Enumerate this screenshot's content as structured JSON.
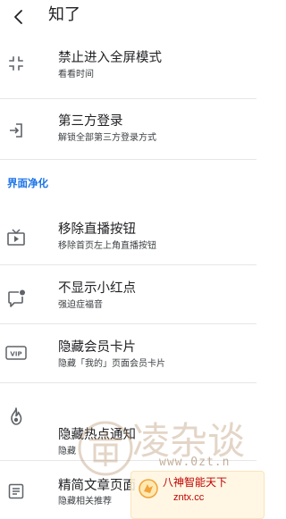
{
  "header": {
    "back_icon": "chevron-left-icon",
    "title": "知了"
  },
  "items": [
    {
      "icon": "fullscreen-exit-icon",
      "title": "禁止进入全屏模式",
      "subtitle": "看看时间"
    },
    {
      "icon": "login-icon",
      "title": "第三方登录",
      "subtitle": "解锁全部第三方登录方式"
    }
  ],
  "section": {
    "title": "界面净化",
    "accent": "#1a73e8"
  },
  "purify_items": [
    {
      "icon": "live-tv-icon",
      "title": "移除直播按钮",
      "subtitle": "移除首页左上角直播按钮"
    },
    {
      "icon": "chat-badge-icon",
      "title": "不显示小红点",
      "subtitle": "强迫症福音"
    },
    {
      "icon": "vip-icon",
      "title": "隐藏会员卡片",
      "subtitle": "隐藏「我的」页面会员卡片"
    },
    {
      "icon": "hot-flame-icon",
      "title": "隐藏热点通知",
      "subtitle": "隐藏"
    },
    {
      "icon": "article-icon",
      "title": "精简文章页面",
      "subtitle": "隐藏相关推荐"
    }
  ],
  "watermark": {
    "site": "凌杂谈",
    "domain": "www.0zt.n",
    "badge_name": "八神智能天下",
    "badge_url": "zntx.cc"
  }
}
